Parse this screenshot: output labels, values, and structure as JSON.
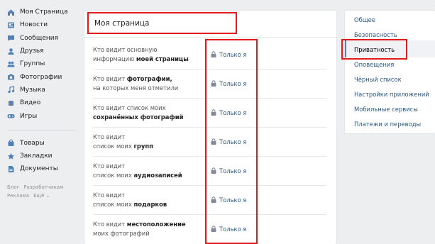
{
  "left_nav": {
    "items": [
      {
        "label": "Моя Страница",
        "icon": "home-icon"
      },
      {
        "label": "Новости",
        "icon": "news-icon"
      },
      {
        "label": "Сообщения",
        "icon": "message-icon"
      },
      {
        "label": "Друзья",
        "icon": "user-icon"
      },
      {
        "label": "Группы",
        "icon": "users-icon"
      },
      {
        "label": "Фотографии",
        "icon": "camera-icon"
      },
      {
        "label": "Музыка",
        "icon": "music-icon"
      },
      {
        "label": "Видео",
        "icon": "video-icon"
      },
      {
        "label": "Игры",
        "icon": "gamepad-icon"
      }
    ],
    "secondary": [
      {
        "label": "Товары",
        "icon": "bag-icon"
      },
      {
        "label": "Закладки",
        "icon": "star-icon"
      },
      {
        "label": "Документы",
        "icon": "document-icon"
      }
    ],
    "footer": [
      "Блог",
      "Разработчикам",
      "Реклама",
      "Ещё ⌄"
    ]
  },
  "main": {
    "title": "Моя страница",
    "rows": [
      {
        "l1": "Кто видит основную",
        "l2a": "информацию ",
        "l2b": "моей страницы",
        "value": "Только я"
      },
      {
        "l1a": "Кто видит ",
        "l1b": "фотографии,",
        "l2": "на которых меня отметили",
        "value": "Только я"
      },
      {
        "l1": "Кто видит список моих",
        "l2b": "сохранённых фотографий",
        "value": "Только я"
      },
      {
        "l1": "Кто видит",
        "l2a": "список моих ",
        "l2b": "групп",
        "value": "Только я"
      },
      {
        "l1": "Кто видит",
        "l2a": "список моих ",
        "l2b": "аудиозаписей",
        "value": "Только я"
      },
      {
        "l1": "Кто видит",
        "l2a": "список моих ",
        "l2b": "подарков",
        "value": "Только я"
      },
      {
        "l1a": "Кто видит ",
        "l1b": "местоположение",
        "l2": "моих фотографий",
        "value": "Только я"
      }
    ]
  },
  "right_menu": {
    "items": [
      "Общее",
      "Безопасность",
      "Приватность",
      "Оповещения",
      "Чёрный список",
      "Настройки приложений",
      "Мобильные сервисы",
      "Платежи и переводы"
    ],
    "active": "Приватность"
  },
  "colors": {
    "link": "#2a5885",
    "highlight": "#e11b1b",
    "background": "#edeef0",
    "nav_icon": "#5181b8"
  }
}
